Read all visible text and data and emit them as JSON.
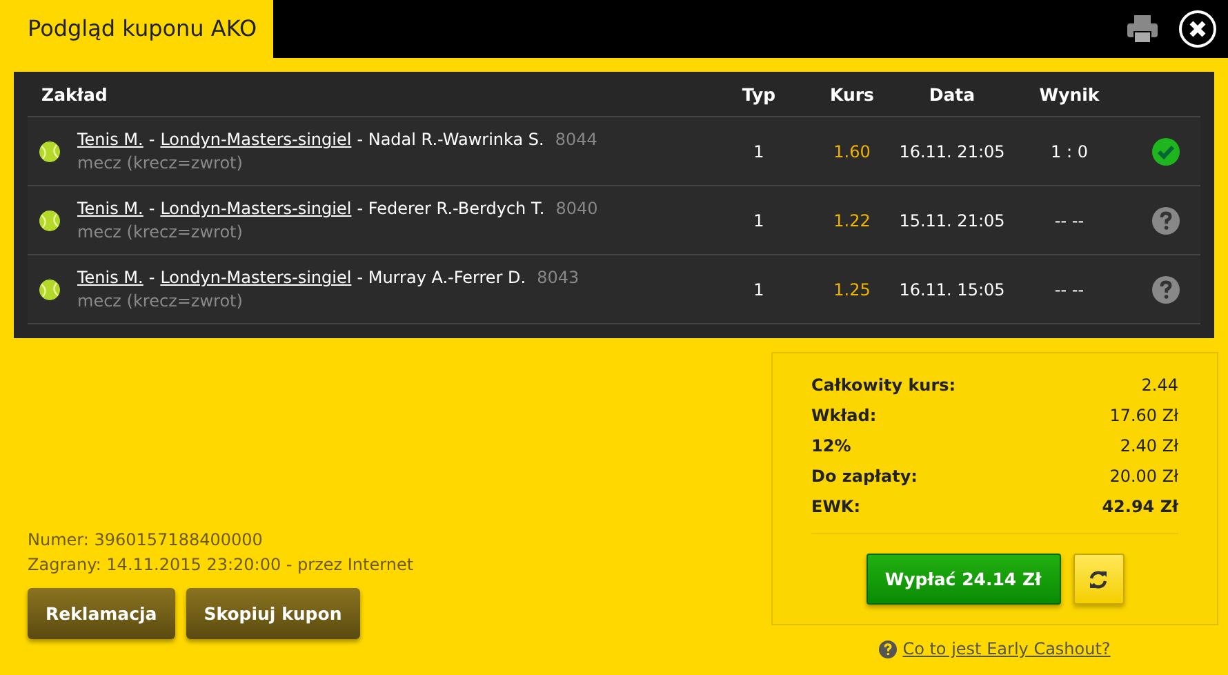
{
  "window": {
    "title": "Podgląd kuponu AKO"
  },
  "table": {
    "columns": [
      "Zakład",
      "Typ",
      "Kurs",
      "Data",
      "Wynik"
    ],
    "rows": [
      {
        "sport": "Tenis M.",
        "separator": "-",
        "league": "Londyn-Masters-singiel",
        "match": "- Nadal R.-Wawrinka S.",
        "code": "8044",
        "market": "mecz (krecz=zwrot)",
        "type": "1",
        "odds": "1.60",
        "date": "16.11. 21:05",
        "result": "1 : 0",
        "kind": "won"
      },
      {
        "sport": "Tenis M.",
        "separator": "-",
        "league": "Londyn-Masters-singiel",
        "match": "- Federer R.-Berdych T.",
        "code": "8040",
        "market": "mecz (krecz=zwrot)",
        "type": "1",
        "odds": "1.22",
        "date": "15.11. 21:05",
        "result": "-- --",
        "kind": "pending"
      },
      {
        "sport": "Tenis M.",
        "separator": "-",
        "league": "Londyn-Masters-singiel",
        "match": "- Murray A.-Ferrer D.",
        "code": "8043",
        "market": "mecz (krecz=zwrot)",
        "type": "1",
        "odds": "1.25",
        "date": "16.11. 15:05",
        "result": "-- --",
        "kind": "pending"
      }
    ]
  },
  "info": {
    "number": "Numer: 3960157188400000",
    "played": "Zagrany: 14.11.2015 23:20:00 - przez Internet"
  },
  "buttons": [
    "Reklamacja",
    "Skopiuj kupon"
  ],
  "summary": {
    "rows": [
      {
        "label": "Całkowity kurs:",
        "value": "2.44",
        "bold": false
      },
      {
        "label": "Wkład:",
        "value": "17.60 Zł",
        "bold": false
      },
      {
        "label": "12%",
        "value": "2.40 Zł",
        "bold": false
      },
      {
        "label": "Do zapłaty:",
        "value": "20.00 Zł",
        "bold": false
      },
      {
        "label": "EWK:",
        "value": "42.94 Zł",
        "bold": true
      }
    ],
    "cashout": "Wypłać 24.14 Zł",
    "help_link": "Co to jest Early Cashout?"
  }
}
